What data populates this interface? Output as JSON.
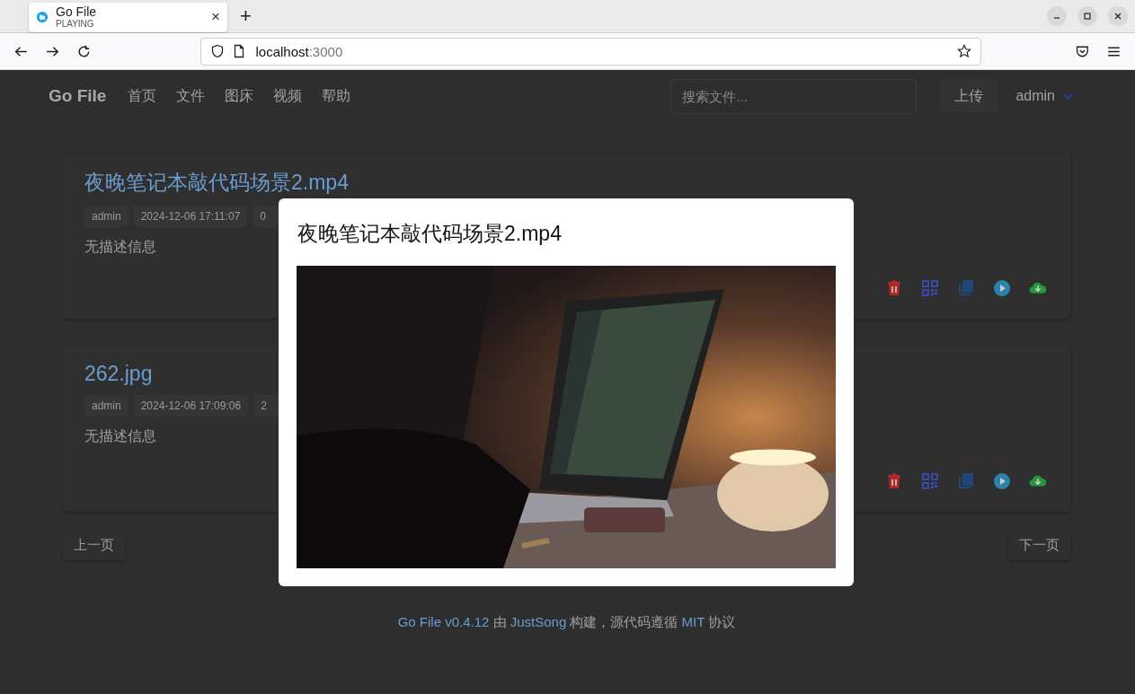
{
  "browser": {
    "tab": {
      "title": "Go File",
      "subtitle": "PLAYING",
      "close": "×"
    },
    "new_tab": "+",
    "address": {
      "host": "localhost",
      "port": ":3000"
    }
  },
  "navbar": {
    "brand": "Go File",
    "links": [
      "首页",
      "文件",
      "图床",
      "视频",
      "帮助"
    ],
    "search": {
      "placeholder": "搜索文件..."
    },
    "upload": "上传",
    "user": "admin"
  },
  "files": [
    {
      "name": "夜晚笔记本敲代码场景2.mp4",
      "tags": [
        "admin",
        "2024-12-06 17:11:07",
        "0"
      ],
      "description": "无描述信息",
      "actions": [
        {
          "kind": "delete"
        },
        {
          "kind": "qrcode"
        },
        {
          "kind": "copy"
        },
        {
          "kind": "play"
        },
        {
          "kind": "download"
        }
      ]
    },
    {
      "name": "262.jpg",
      "tags": [
        "admin",
        "2024-12-06 17:09:06",
        "2"
      ],
      "description": "无描述信息",
      "actions": [
        {
          "kind": "delete"
        },
        {
          "kind": "qrcode"
        },
        {
          "kind": "copy"
        },
        {
          "kind": "play"
        },
        {
          "kind": "download"
        }
      ]
    }
  ],
  "pagination": {
    "prev": "上一页",
    "next": "下一页"
  },
  "footer": [
    {
      "text": "Go File v0.4.12",
      "link": true
    },
    {
      "text": " 由 ",
      "link": false
    },
    {
      "text": "JustSong",
      "link": true
    },
    {
      "text": " 构建，源代码遵循 ",
      "link": false
    },
    {
      "text": "MIT",
      "link": true
    },
    {
      "text": " 协议",
      "link": false
    }
  ],
  "modal": {
    "title": "夜晚笔记本敲代码场景2.mp4"
  }
}
